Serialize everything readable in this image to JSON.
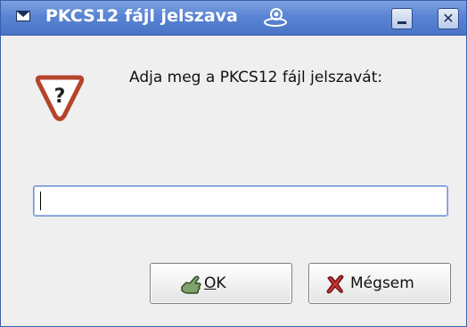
{
  "window": {
    "title": "PKCS12 fájl jelszava"
  },
  "dialog": {
    "prompt": "Adja meg a PKCS12 fájl jelszavát:",
    "password_value": ""
  },
  "buttons": {
    "ok_prefix": "",
    "ok_mnemonic": "O",
    "ok_rest": "K",
    "cancel_prefix": "Mé",
    "cancel_mnemonic": "g",
    "cancel_rest": "sem"
  },
  "icons": {
    "window_menu": "window-menu-icon",
    "title_swirl": "swirl-icon",
    "minimize": "minimize-icon",
    "close": "close-icon",
    "question": "question-icon",
    "ok": "ok-hand-icon",
    "cancel": "cancel-x-icon"
  },
  "colors": {
    "titlebar": "#5a84d3",
    "question_icon": "#b5442c"
  }
}
